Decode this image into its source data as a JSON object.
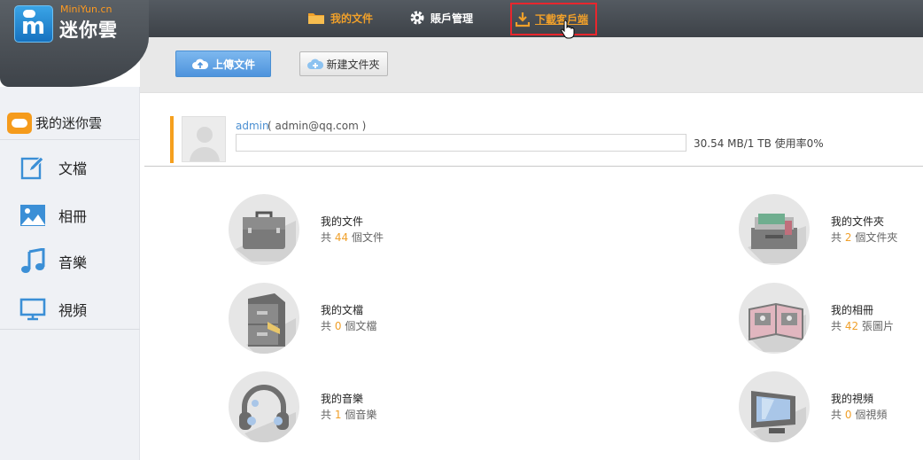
{
  "brand": {
    "site": "MiniYun.cn",
    "name": "迷你雲"
  },
  "nav": {
    "files": "我的文件",
    "account": "賬戶管理",
    "download": "下載客戶端"
  },
  "toolbar": {
    "upload": "上傳文件",
    "new_folder": "新建文件夾"
  },
  "sidebar": {
    "title": "我的迷你雲",
    "items": [
      {
        "label": "文檔",
        "icon": "edit-icon"
      },
      {
        "label": "相冊",
        "icon": "image-icon"
      },
      {
        "label": "音樂",
        "icon": "music-icon"
      },
      {
        "label": "視頻",
        "icon": "monitor-icon"
      }
    ]
  },
  "user": {
    "name": "admin",
    "email": "( admin@qq.com )",
    "quota_text": "30.54 MB/1 TB  使用率0%",
    "usage_fraction": 0
  },
  "cards": {
    "files": {
      "title": "我的文件",
      "prefix": "共",
      "num": "44",
      "suffix": "個文件"
    },
    "folders": {
      "title": "我的文件夾",
      "prefix": "共",
      "num": "2",
      "suffix": "個文件夾"
    },
    "docs": {
      "title": "我的文檔",
      "prefix": "共",
      "num": "0",
      "suffix": "個文檔"
    },
    "albums": {
      "title": "我的相冊",
      "prefix": "共",
      "num": "42",
      "suffix": "張圖片"
    },
    "music": {
      "title": "我的音樂",
      "prefix": "共",
      "num": "1",
      "suffix": "個音樂"
    },
    "videos": {
      "title": "我的視頻",
      "prefix": "共",
      "num": "0",
      "suffix": "個視頻"
    }
  },
  "colors": {
    "accent": "#f0a02a",
    "link": "#4a8fd2",
    "highlight_border": "#e8262d",
    "sidebar_bg": "#eff1f5"
  }
}
